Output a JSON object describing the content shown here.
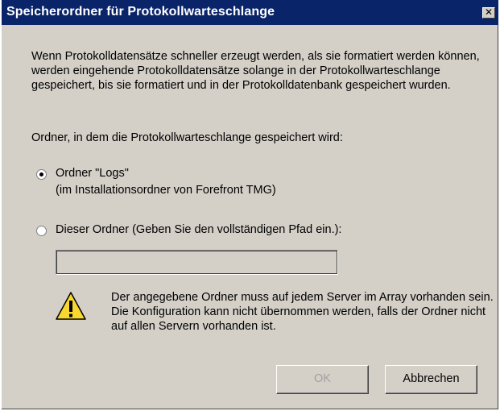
{
  "window": {
    "title": "Speicherordner für Protokollwarteschlange",
    "close_symbol": "✕"
  },
  "intro_text": "Wenn Protokolldatensätze schneller erzeugt werden, als sie formatiert werden können, werden eingehende Protokolldatensätze solange in der Protokollwarteschlange gespeichert, bis sie formatiert und in der Protokolldatenbank gespeichert wurden.",
  "folder_label": "Ordner, in dem die Protokollwarteschlange gespeichert wird:",
  "options": {
    "logs": {
      "label": "Ordner \"Logs\"",
      "sublabel": "(im Installationsordner von Forefront TMG)",
      "selected": true
    },
    "custom": {
      "label": "Dieser Ordner (Geben Sie den vollständigen Pfad ein.):",
      "selected": false,
      "path_value": ""
    }
  },
  "warning": {
    "icon": "warning-icon",
    "text": "Der angegebene Ordner muss auf jedem Server im Array vorhanden sein. Die Konfiguration kann nicht übernommen werden, falls der Ordner nicht auf allen Servern vorhanden ist."
  },
  "buttons": {
    "ok": "OK",
    "cancel": "Abbrechen"
  },
  "colors": {
    "titlebar": "#0a246a",
    "dialog_bg": "#d4d0c8",
    "disabled_text": "#a0a0a0"
  }
}
